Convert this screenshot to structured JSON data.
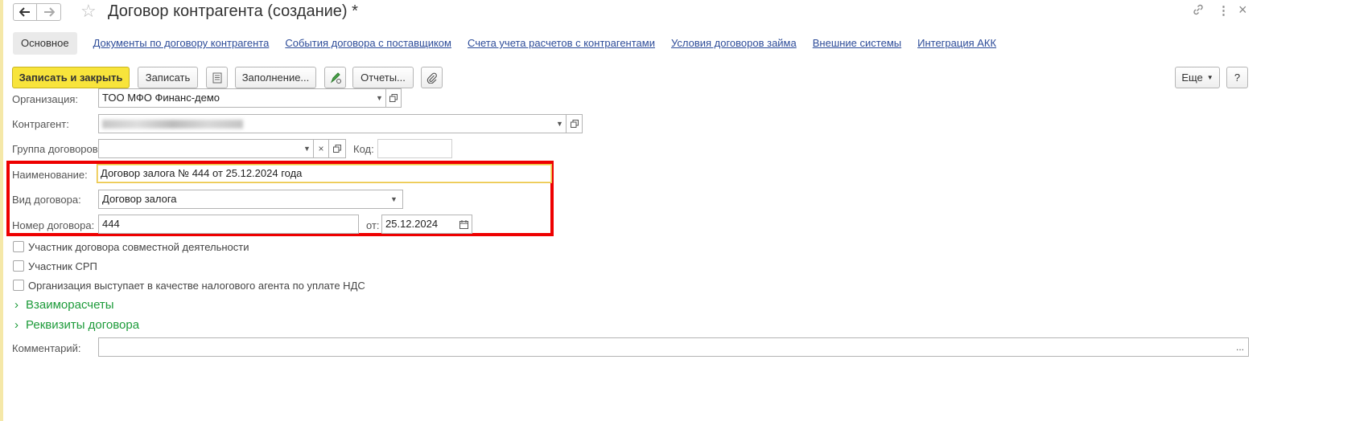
{
  "window": {
    "title": "Договор контрагента (создание) *",
    "back_icon": "arrow-left-icon",
    "forward_icon": "arrow-right-icon",
    "favorite_icon": "star-icon",
    "link_icon": "link-icon",
    "menu_icon": "more-vertical-icon",
    "close_label": "×"
  },
  "tabs": [
    {
      "label": "Основное",
      "active": true
    },
    {
      "label": "Документы по договору контрагента"
    },
    {
      "label": "События договора с поставщиком"
    },
    {
      "label": "Счета учета расчетов с контрагентами"
    },
    {
      "label": "Условия договоров займа"
    },
    {
      "label": "Внешние системы"
    },
    {
      "label": "Интеграция АКК"
    }
  ],
  "toolbar": {
    "save_close": "Записать и закрыть",
    "save": "Записать",
    "fill": "Заполнение...",
    "reports": "Отчеты...",
    "more": "Еще",
    "help": "?"
  },
  "form": {
    "organization": {
      "label": "Организация:",
      "value": "ТОО МФО Финанс-демо"
    },
    "counterparty": {
      "label": "Контрагент:",
      "value": ""
    },
    "group": {
      "label": "Группа договоров:",
      "value": "",
      "code_label": "Код:",
      "code_value": ""
    },
    "name": {
      "label": "Наименование:",
      "value": "Договор залога № 444 от 25.12.2024 года"
    },
    "type": {
      "label": "Вид договора:",
      "value": "Договор залога"
    },
    "number": {
      "label": "Номер договора:",
      "value": "444",
      "date_label": "от:",
      "date_value": "25.12.2024"
    }
  },
  "checkboxes": [
    {
      "label": "Участник договора совместной деятельности",
      "checked": false
    },
    {
      "label": "Участник СРП",
      "checked": false
    },
    {
      "label": "Организация выступает в качестве налогового агента по уплате НДС",
      "checked": false
    }
  ],
  "sections": [
    {
      "label": "Взаиморасчеты",
      "expanded": false
    },
    {
      "label": "Реквизиты договора",
      "expanded": false
    }
  ],
  "comment": {
    "label": "Комментарий:",
    "value": "",
    "button": "..."
  },
  "colors": {
    "accent_yellow": "#f8e43b",
    "link": "#2d4c99",
    "section_green": "#1d9b3a",
    "highlight_red": "#ee0000"
  }
}
